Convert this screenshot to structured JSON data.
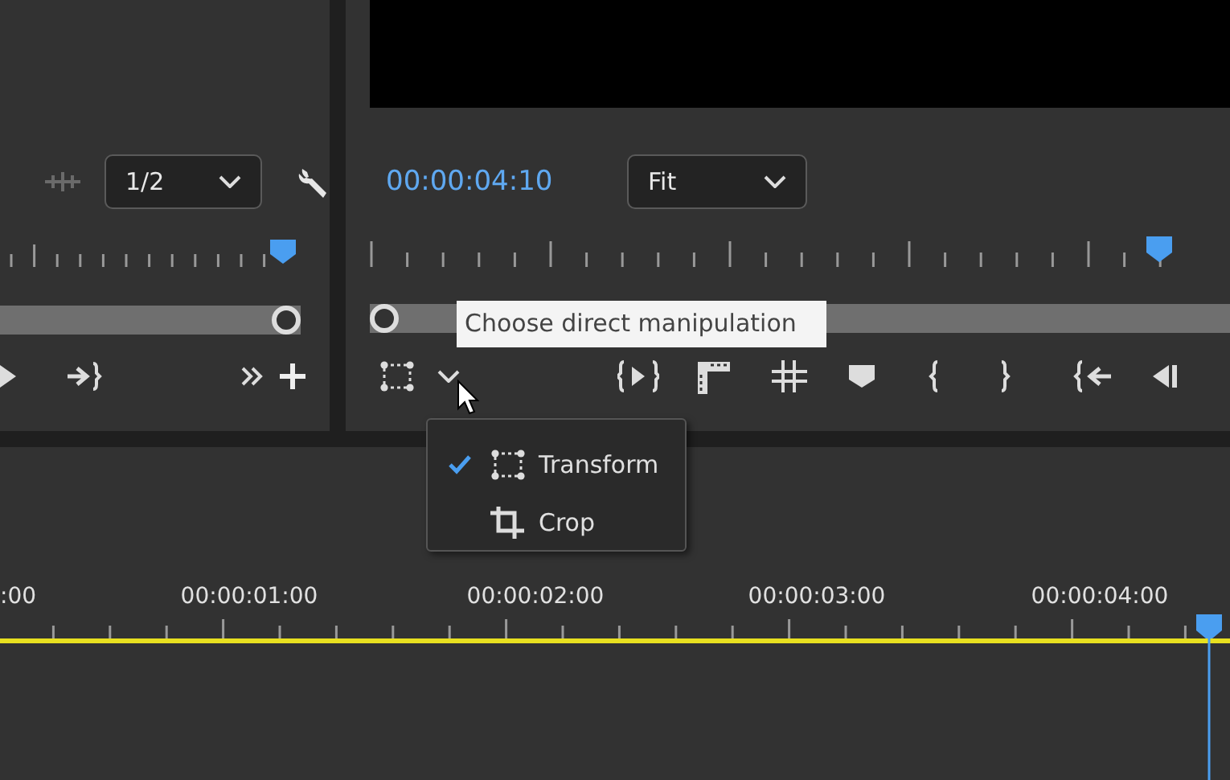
{
  "source_monitor": {
    "resolution_dropdown": {
      "value": "1/2"
    }
  },
  "program_monitor": {
    "timecode": "00:00:04:10",
    "zoom_dropdown": {
      "value": "Fit"
    }
  },
  "tooltip": {
    "text": "Choose direct manipulation"
  },
  "manipulation_menu": {
    "items": [
      {
        "kind": "transform",
        "label": "Transform",
        "selected": true
      },
      {
        "kind": "crop",
        "label": "Crop",
        "selected": false
      }
    ]
  },
  "timeline": {
    "time_labels": [
      ":00",
      "00:00:01:00",
      "00:00:02:00",
      "00:00:03:00",
      "00:00:04:00"
    ]
  }
}
